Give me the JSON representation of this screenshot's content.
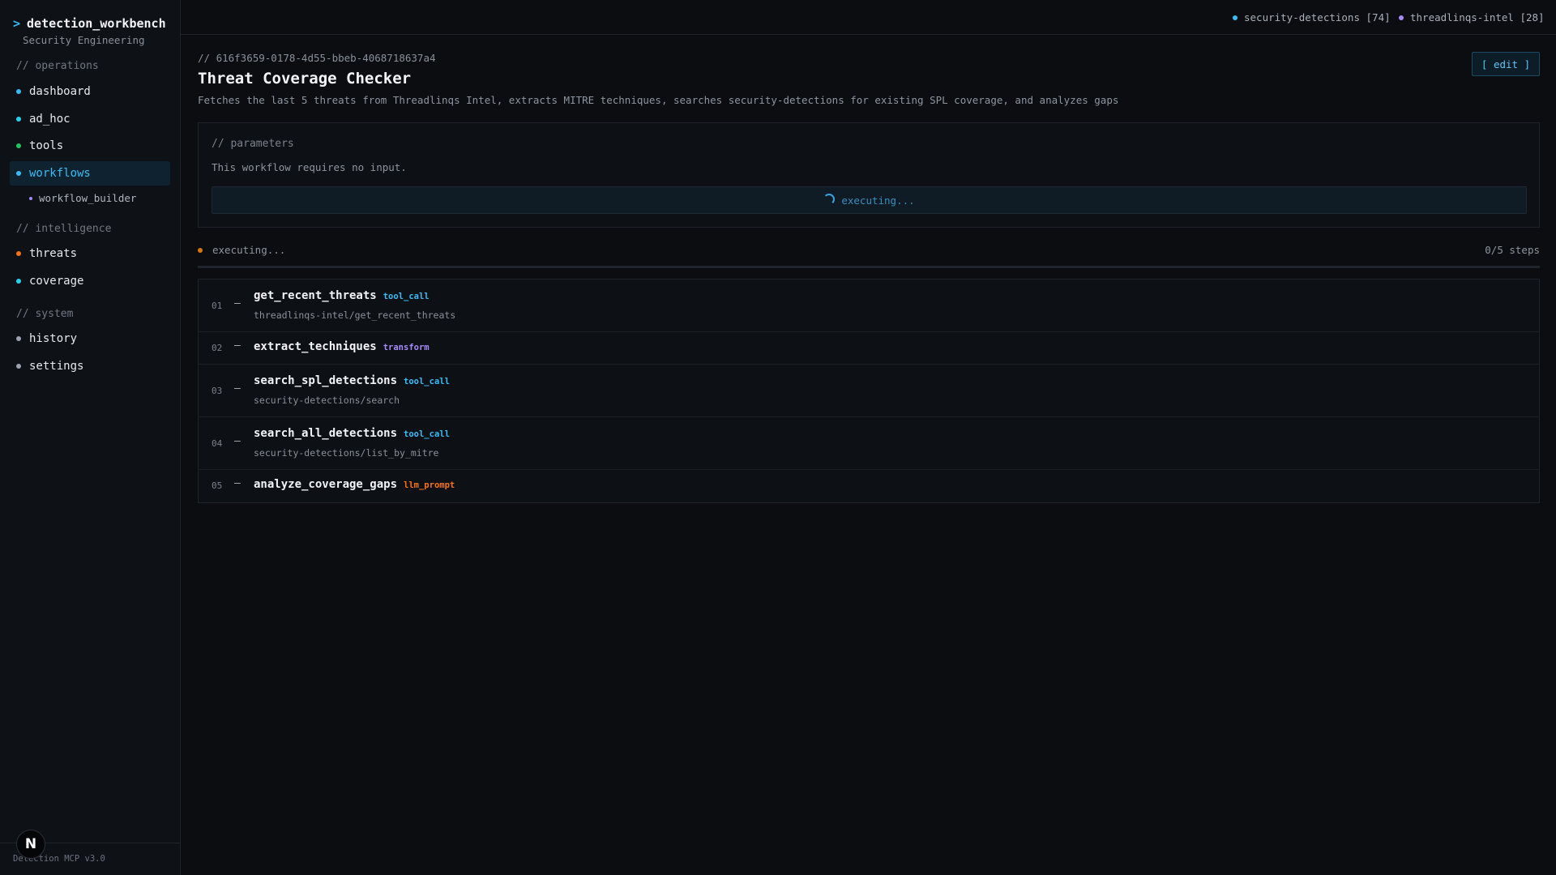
{
  "app": {
    "prompt": ">",
    "name": "detection_workbench",
    "subtitle": "Security Engineering",
    "version": "Detection MCP v3.0",
    "badge": "N"
  },
  "sidebar": {
    "sections": [
      "// operations",
      "// intelligence",
      "// system"
    ],
    "items": [
      {
        "label": "dashboard",
        "dot": "#38bdf8"
      },
      {
        "label": "ad_hoc",
        "dot": "#22d3ee"
      },
      {
        "label": "tools",
        "dot": "#22c55e"
      },
      {
        "label": "workflows",
        "dot": "#38bdf8"
      },
      {
        "label": "threats",
        "dot": "#f97316"
      },
      {
        "label": "coverage",
        "dot": "#22d3ee"
      },
      {
        "label": "history",
        "dot": "#9ca3af"
      },
      {
        "label": "settings",
        "dot": "#9ca3af"
      }
    ],
    "subitems": [
      {
        "label": "workflow_builder"
      }
    ]
  },
  "topbar": {
    "connections": [
      {
        "label": "security-detections [74]",
        "color": "#38bdf8"
      },
      {
        "label": "threadlinqs-intel [28]",
        "color": "#a78bfa"
      }
    ]
  },
  "workflow": {
    "id": "// 616f3659-0178-4d55-bbeb-4068718637a4",
    "title": "Threat Coverage Checker",
    "description": "Fetches the last 5 threats from Threadlinqs Intel, extracts MITRE techniques, searches security-detections for existing SPL coverage, and analyzes gaps",
    "edit_label": "[ edit ]"
  },
  "parameters": {
    "label": "// parameters",
    "note": "This workflow requires no input.",
    "execute_label": "executing..."
  },
  "status": {
    "text": "executing...",
    "count": "0/5 steps",
    "progress": 0
  },
  "steps": [
    {
      "num": "01",
      "dash": "—",
      "name": "get_recent_threats",
      "type": "tool_call",
      "type_color": "#38bdf8",
      "path": "threadlinqs-intel/get_recent_threats"
    },
    {
      "num": "02",
      "dash": "—",
      "name": "extract_techniques",
      "type": "transform",
      "type_color": "#a78bfa"
    },
    {
      "num": "03",
      "dash": "—",
      "name": "search_spl_detections",
      "type": "tool_call",
      "type_color": "#38bdf8",
      "path": "security-detections/search"
    },
    {
      "num": "04",
      "dash": "—",
      "name": "search_all_detections",
      "type": "tool_call",
      "type_color": "#38bdf8",
      "path": "security-detections/list_by_mitre"
    },
    {
      "num": "05",
      "dash": "—",
      "name": "analyze_coverage_gaps",
      "type": "llm_prompt",
      "type_color": "#f97316"
    }
  ]
}
